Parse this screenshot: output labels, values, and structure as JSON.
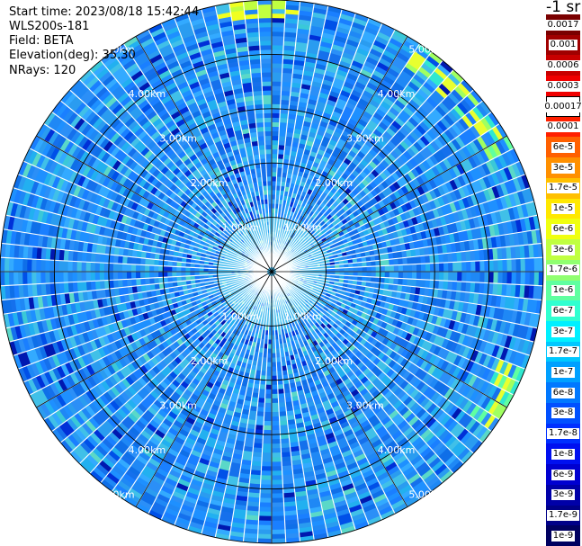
{
  "header": {
    "start_time": "Start time: 2023/08/18 15:42:44",
    "instrument": "WLS200s-181",
    "field": "Field: BETA",
    "elevation": "Elevation(deg): 35.30",
    "nrays": "NRays: 120"
  },
  "chart_data": {
    "type": "heatmap",
    "subtype": "polar-ppi",
    "rays": 120,
    "max_range_km": 5.0,
    "range_ring_labels": [
      "1.00km",
      "2.00km",
      "3.00km",
      "4.00km",
      "5.00km"
    ],
    "colorbar": {
      "unit_label": "-1 sr",
      "levels": [
        "0.0017",
        "0.001",
        "0.0006",
        "0.0003",
        "0.00017",
        "0.0001",
        "6e-5",
        "3e-5",
        "1.7e-5",
        "1e-5",
        "6e-6",
        "3e-6",
        "1.7e-6",
        "1e-6",
        "6e-7",
        "3e-7",
        "1.7e-7",
        "1e-7",
        "6e-8",
        "3e-8",
        "1.7e-8",
        "1e-8",
        "6e-9",
        "3e-9",
        "1.7e-9",
        "1e-9"
      ],
      "colors": [
        "#7a0000",
        "#a00000",
        "#c80000",
        "#f00000",
        "#ffffff",
        "#ff2000",
        "#ff6000",
        "#ff9000",
        "#ffc000",
        "#ffe800",
        "#f0ff10",
        "#c0ff40",
        "#90ff70",
        "#60ffa0",
        "#30ffd0",
        "#00f0ff",
        "#00c8ff",
        "#00a0ff",
        "#0078ff",
        "#0050ff",
        "#0030ff",
        "#0010f0",
        "#0000d0",
        "#0000a8",
        "#000088",
        "#000060"
      ]
    }
  }
}
